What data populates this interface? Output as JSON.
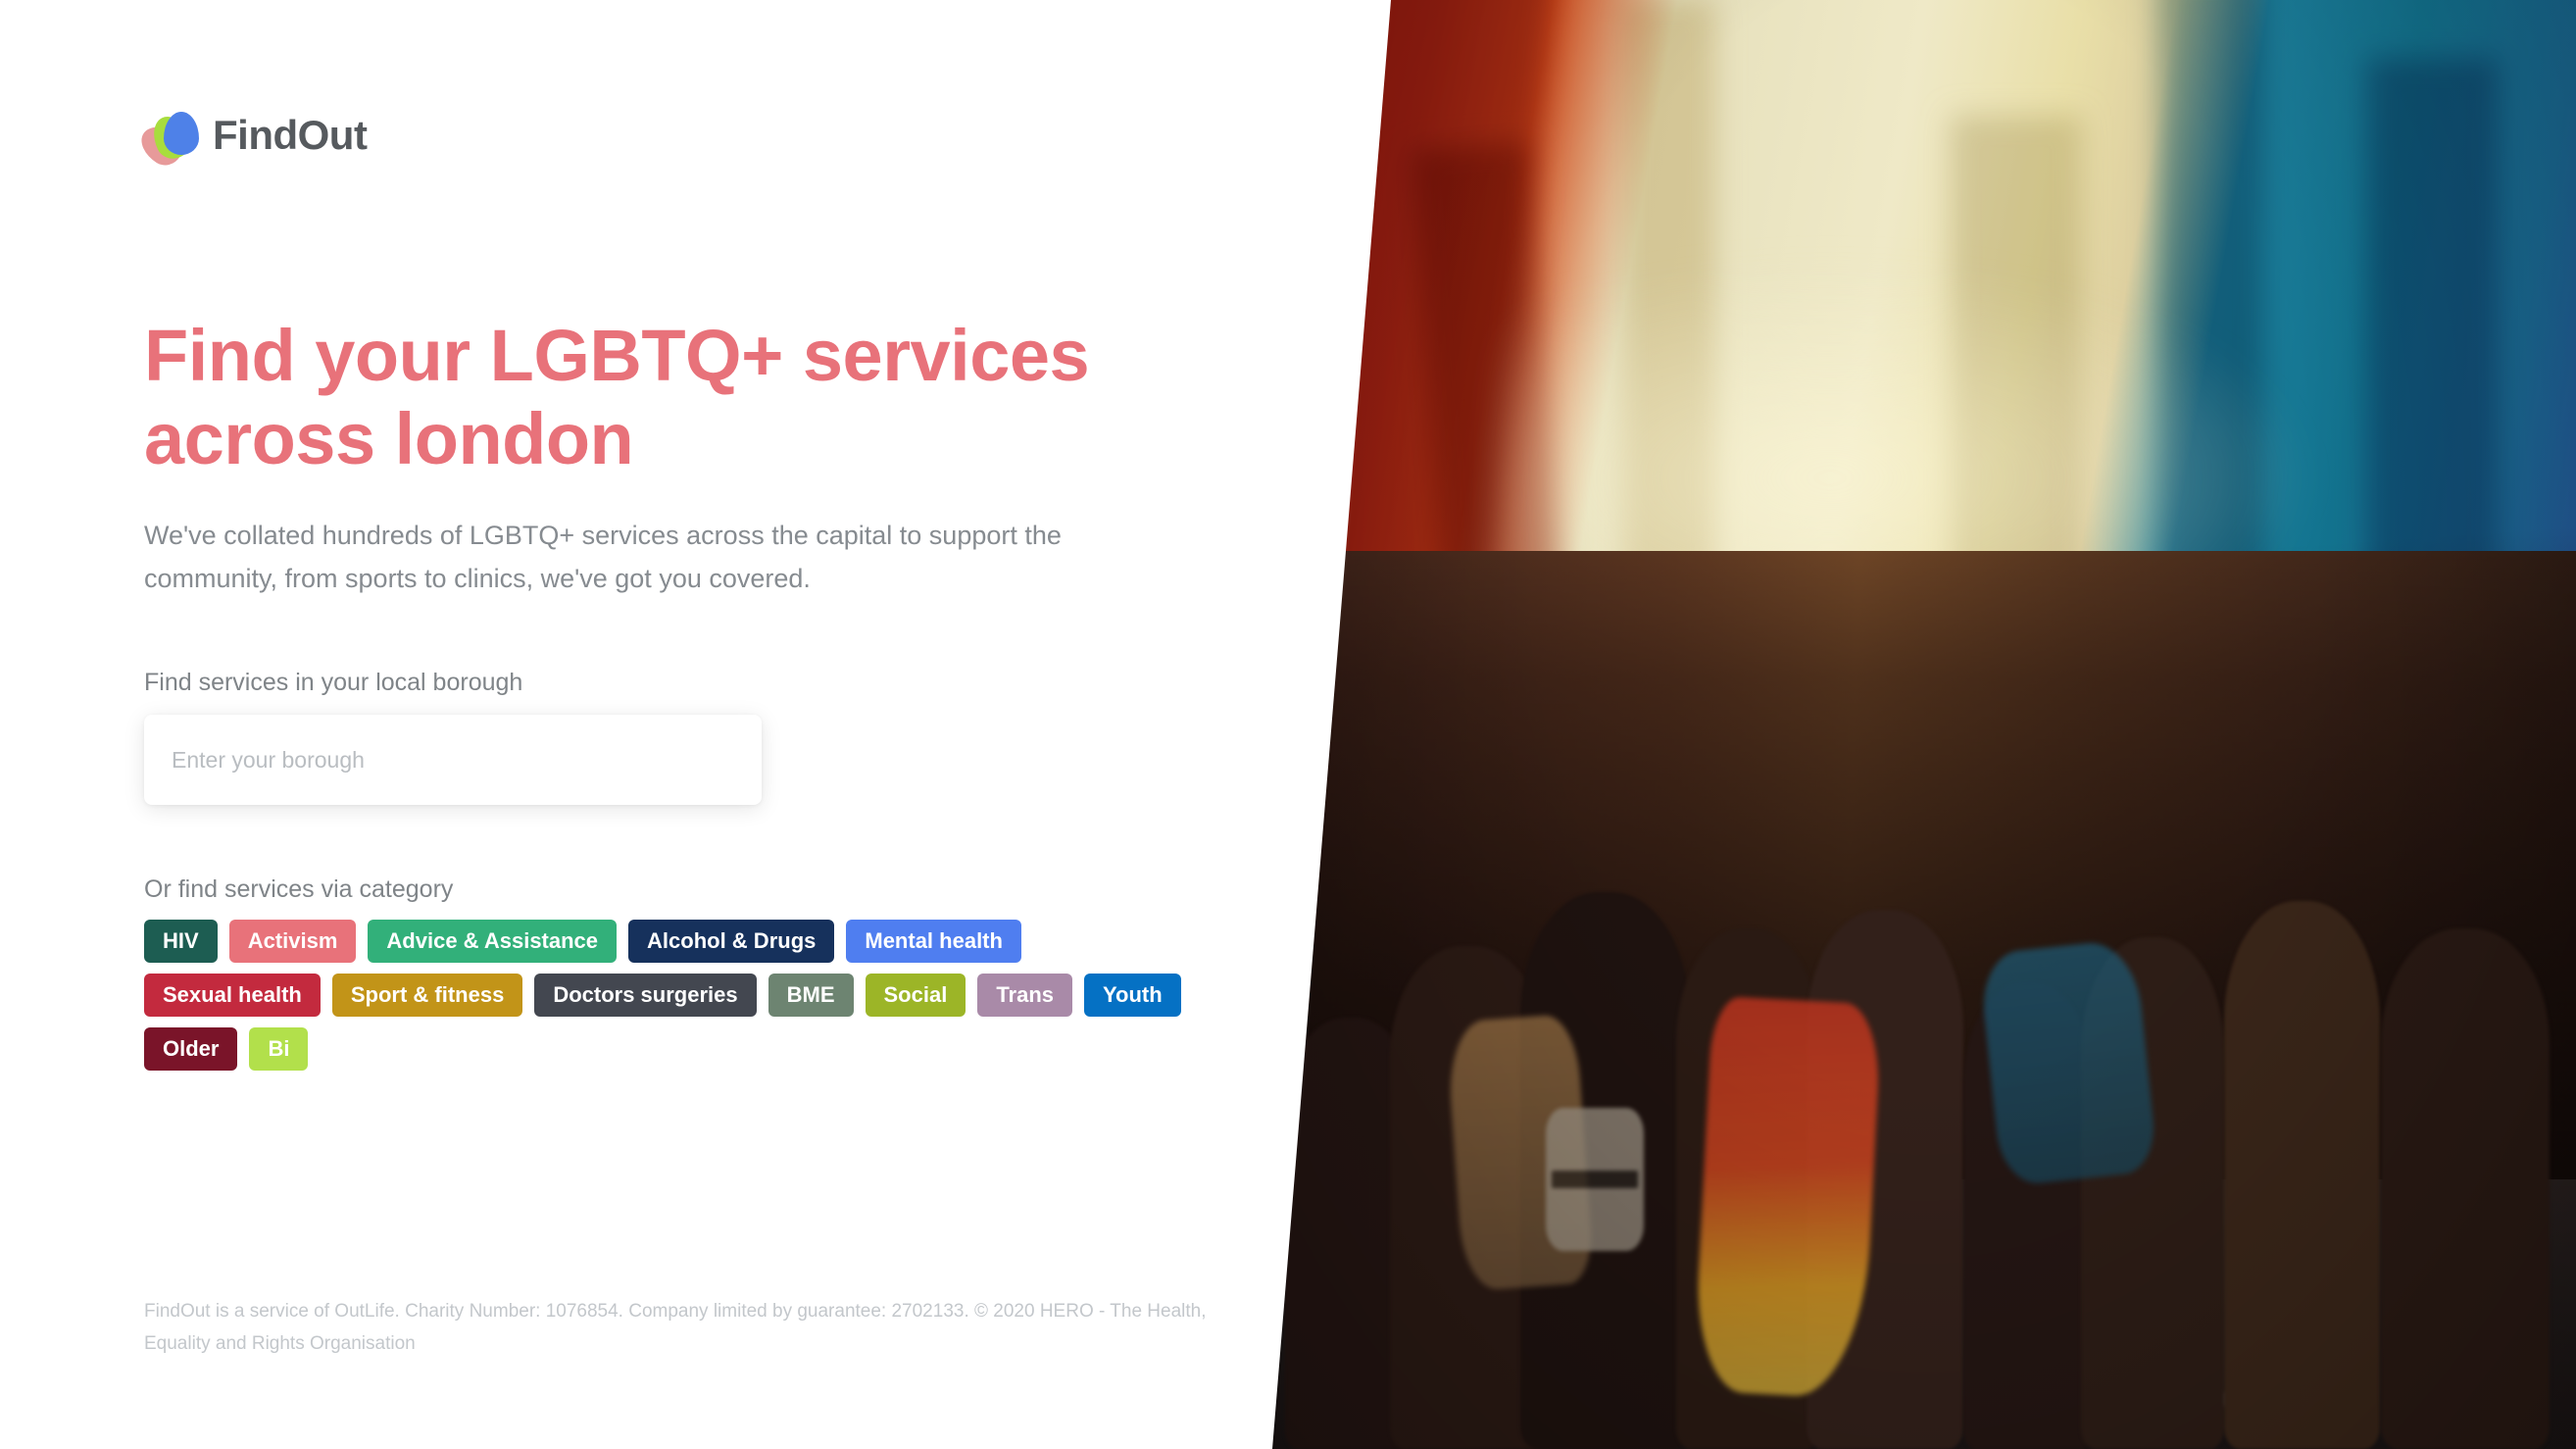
{
  "brand": {
    "name": "FindOut",
    "logo_icon": "findout-petals-logo",
    "colors": {
      "petal_pink": "#e79a9a",
      "petal_green": "#a8dd3d",
      "petal_blue": "#4e81e8",
      "wordmark": "#565a5e",
      "accent": "#e8727a"
    }
  },
  "hero": {
    "headline": "Find your LGBTQ+ services across london",
    "subtitle": "We've collated hundreds of LGBTQ+ services across the capital to support the community, from sports to clinics, we've got you covered."
  },
  "search": {
    "label": "Find services in your local borough",
    "placeholder": "Enter your borough",
    "value": ""
  },
  "categories": {
    "label": "Or find services via category",
    "items": [
      {
        "label": "HIV",
        "color": "#1d5d52"
      },
      {
        "label": "Activism",
        "color": "#e8727a"
      },
      {
        "label": "Advice & Assistance",
        "color": "#32b07a"
      },
      {
        "label": "Alcohol & Drugs",
        "color": "#16315c"
      },
      {
        "label": "Mental health",
        "color": "#4f7ef0"
      },
      {
        "label": "Sexual health",
        "color": "#c32a3e"
      },
      {
        "label": "Sport & fitness",
        "color": "#c29418"
      },
      {
        "label": "Doctors surgeries",
        "color": "#434750"
      },
      {
        "label": "BME",
        "color": "#6d8471"
      },
      {
        "label": "Social",
        "color": "#9cb527"
      },
      {
        "label": "Trans",
        "color": "#a98aa8"
      },
      {
        "label": "Youth",
        "color": "#0571c4"
      },
      {
        "label": "Older",
        "color": "#7a1429"
      },
      {
        "label": "Bi",
        "color": "#b2e04b"
      }
    ]
  },
  "footer": {
    "text": "FindOut is a service of OutLife. Charity Number: 1076854. Company limited by guarantee: 2702133. © 2020 HERO - The Health, Equality and Rights Organisation"
  },
  "hero_image": {
    "alt": "pride-parade-rainbow-flag-photo"
  }
}
